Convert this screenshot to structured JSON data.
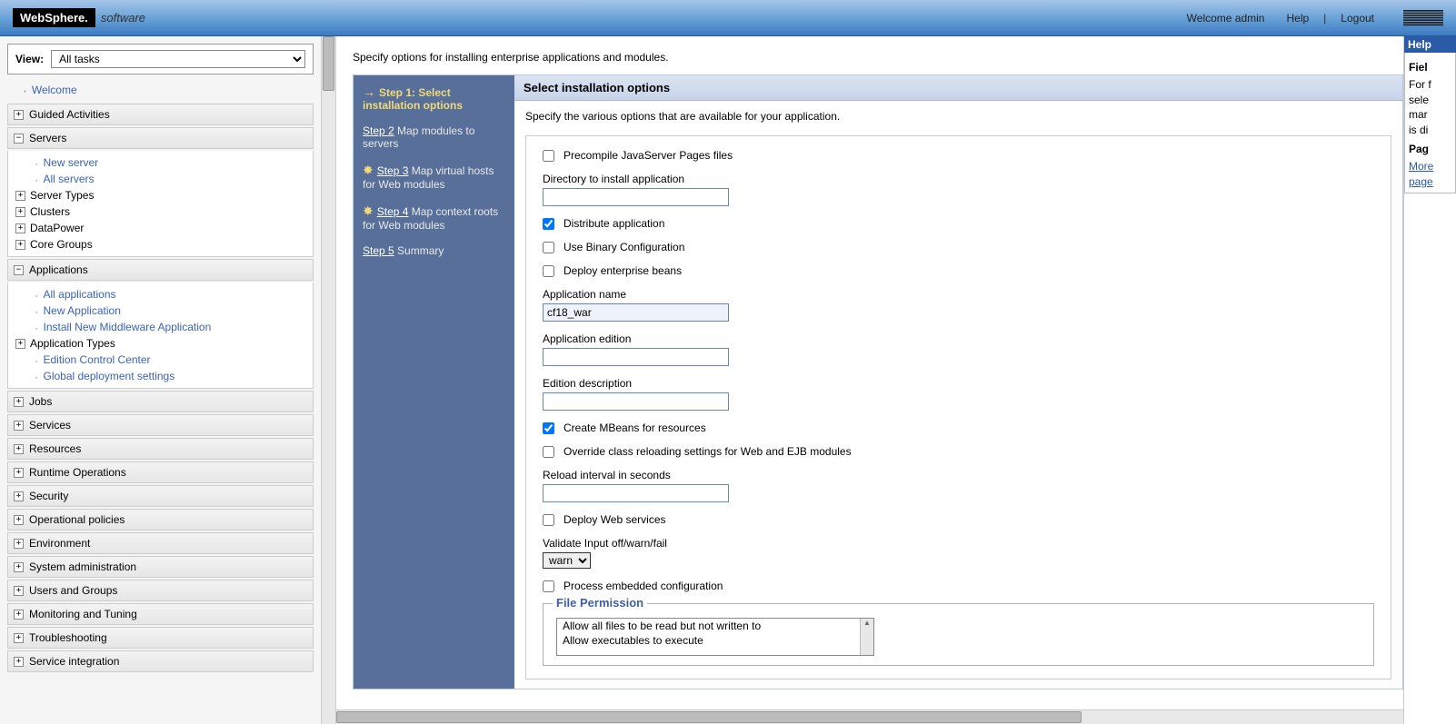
{
  "header": {
    "logo_main": "WebSphere.",
    "logo_suffix": "software",
    "welcome": "Welcome admin",
    "help": "Help",
    "logout": "Logout",
    "ibm": "IBM."
  },
  "nav": {
    "view_label": "View:",
    "view_value": "All tasks",
    "welcome_link": "Welcome",
    "groups": [
      {
        "label": "Guided Activities",
        "expanded": false
      },
      {
        "label": "Servers",
        "expanded": true,
        "children": [
          {
            "type": "link",
            "label": "New server"
          },
          {
            "type": "link",
            "label": "All servers"
          },
          {
            "type": "group",
            "label": "Server Types"
          },
          {
            "type": "group",
            "label": "Clusters"
          },
          {
            "type": "group",
            "label": "DataPower"
          },
          {
            "type": "group",
            "label": "Core Groups"
          }
        ]
      },
      {
        "label": "Applications",
        "expanded": true,
        "children": [
          {
            "type": "link",
            "label": "All applications"
          },
          {
            "type": "link",
            "label": "New Application"
          },
          {
            "type": "link",
            "label": "Install New Middleware Application"
          },
          {
            "type": "group",
            "label": "Application Types"
          },
          {
            "type": "link",
            "label": "Edition Control Center"
          },
          {
            "type": "link",
            "label": "Global deployment settings"
          }
        ]
      },
      {
        "label": "Jobs",
        "expanded": false
      },
      {
        "label": "Services",
        "expanded": false
      },
      {
        "label": "Resources",
        "expanded": false
      },
      {
        "label": "Runtime Operations",
        "expanded": false
      },
      {
        "label": "Security",
        "expanded": false
      },
      {
        "label": "Operational policies",
        "expanded": false
      },
      {
        "label": "Environment",
        "expanded": false
      },
      {
        "label": "System administration",
        "expanded": false
      },
      {
        "label": "Users and Groups",
        "expanded": false
      },
      {
        "label": "Monitoring and Tuning",
        "expanded": false
      },
      {
        "label": "Troubleshooting",
        "expanded": false
      },
      {
        "label": "Service integration",
        "expanded": false
      }
    ]
  },
  "main": {
    "intro": "Specify options for installing enterprise applications and modules.",
    "steps": [
      {
        "num": "Step 1:",
        "title": "Select installation options",
        "current": true
      },
      {
        "num": "Step 2",
        "title": "Map modules to servers"
      },
      {
        "num": "Step 3",
        "title": "Map virtual hosts for Web modules",
        "star": true
      },
      {
        "num": "Step 4",
        "title": "Map context roots for Web modules",
        "star": true
      },
      {
        "num": "Step 5",
        "title": "Summary"
      }
    ],
    "panel_title": "Select installation options",
    "panel_desc": "Specify the various options that are available for your application.",
    "opts": {
      "precompile": "Precompile JavaServer Pages files",
      "dir_label": "Directory to install application",
      "dir_value": "",
      "distribute": "Distribute application",
      "use_binary": "Use Binary Configuration",
      "deploy_ejb": "Deploy enterprise beans",
      "app_name_label": "Application name",
      "app_name_value": "cf18_war",
      "app_edition_label": "Application edition",
      "app_edition_value": "",
      "edition_desc_label": "Edition description",
      "edition_desc_value": "",
      "create_mbeans": "Create MBeans for resources",
      "override_reload": "Override class reloading settings for Web and EJB modules",
      "reload_label": "Reload interval in seconds",
      "reload_value": "",
      "deploy_ws": "Deploy Web services",
      "validate_label": "Validate Input off/warn/fail",
      "validate_value": "warn",
      "process_embedded": "Process embedded configuration",
      "file_perm_title": "File Permission",
      "perm_items": [
        "Allow all files to be read but not written to",
        "Allow executables to execute"
      ]
    }
  },
  "help_panel": {
    "header": "Help",
    "field_help_title": "Fiel",
    "field_help_body": "For f\nsele\nmar\nis di",
    "page_help_title": "Pag",
    "more_link": "More",
    "page_link": "page"
  }
}
